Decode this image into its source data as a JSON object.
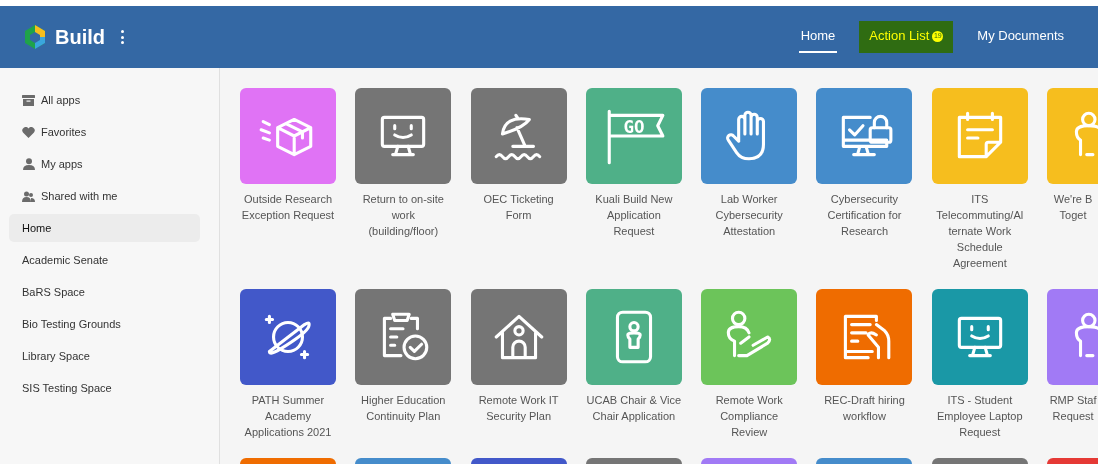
{
  "header": {
    "brand": "Build",
    "nav": [
      {
        "label": "Home",
        "selected": true,
        "highlighted": false
      },
      {
        "label": "Action List",
        "selected": false,
        "highlighted": true,
        "badge": "19"
      },
      {
        "label": "My Documents",
        "selected": false,
        "highlighted": false
      }
    ]
  },
  "sidebar": {
    "items": [
      {
        "label": "All apps",
        "kind": "archive",
        "selected": false
      },
      {
        "label": "Favorites",
        "kind": "heart",
        "selected": false
      },
      {
        "label": "My apps",
        "kind": "person",
        "selected": false
      },
      {
        "label": "Shared with me",
        "kind": "people",
        "selected": false
      },
      {
        "label": "Home",
        "kind": "space",
        "selected": true
      },
      {
        "label": "Academic Senate",
        "kind": "space",
        "selected": false
      },
      {
        "label": "BaRS Space",
        "kind": "space",
        "selected": false
      },
      {
        "label": "Bio Testing Grounds",
        "kind": "space",
        "selected": false
      },
      {
        "label": "Library Space",
        "kind": "space",
        "selected": false
      },
      {
        "label": "SIS Testing Space",
        "kind": "space",
        "selected": false
      }
    ]
  },
  "apps": [
    [
      {
        "kind": "box",
        "color": "#e073f5",
        "lines": [
          "Outside Research",
          "Exception Request"
        ]
      },
      {
        "kind": "monitor",
        "color": "#757575",
        "lines": [
          "Return to on-site",
          "work",
          "(building/floor)"
        ]
      },
      {
        "kind": "umbrella",
        "color": "#757575",
        "lines": [
          "OEC Ticketing",
          "Form"
        ]
      },
      {
        "kind": "flag",
        "color": "#4fb088",
        "flag_text": "GO",
        "lines": [
          "Kuali Build New",
          "Application",
          "Request"
        ]
      },
      {
        "kind": "hand",
        "color": "#458ccb",
        "lines": [
          "Lab Worker",
          "Cybersecurity",
          "Attestation"
        ]
      },
      {
        "kind": "lock",
        "color": "#458ccb",
        "lines": [
          "Cybersecurity",
          "Certification for",
          "Research"
        ]
      },
      {
        "kind": "note",
        "color": "#f6be1e",
        "lines": [
          "ITS",
          "Telecommuting/Al",
          "ternate Work",
          "Schedule",
          "Agreement"
        ]
      },
      {
        "kind": "people",
        "color": "#f6be1e",
        "lines": [
          "We're B",
          "Toget"
        ]
      }
    ],
    [
      {
        "kind": "planet",
        "color": "#4258c9",
        "lines": [
          "PATH Summer",
          "Academy",
          "Applications 2021"
        ]
      },
      {
        "kind": "clipboard",
        "color": "#757575",
        "lines": [
          "Higher Education",
          "Continuity Plan"
        ]
      },
      {
        "kind": "house",
        "color": "#757575",
        "lines": [
          "Remote Work IT",
          "Security Plan"
        ]
      },
      {
        "kind": "badge",
        "color": "#4fb088",
        "lines": [
          "UCAB Chair & Vice",
          "Chair Application"
        ]
      },
      {
        "kind": "person",
        "color": "#6cc45a",
        "lines": [
          "Remote Work",
          "Compliance",
          "Review"
        ]
      },
      {
        "kind": "document",
        "color": "#ef6c00",
        "lines": [
          "REC-Draft hiring",
          "workflow"
        ]
      },
      {
        "kind": "monitor",
        "color": "#1a98a6",
        "lines": [
          "ITS - Student",
          "Employee Laptop",
          "Request"
        ]
      },
      {
        "kind": "people",
        "color": "#a17af5",
        "lines": [
          "RMP Staf",
          "Request"
        ]
      }
    ],
    [
      {
        "color": "#ef6c00"
      },
      {
        "color": "#458ccb"
      },
      {
        "color": "#4258c9"
      },
      {
        "color": "#757575"
      },
      {
        "color": "#a17af5"
      },
      {
        "color": "#458ccb"
      },
      {
        "color": "#757575"
      },
      {
        "color": "#e53935"
      }
    ]
  ]
}
